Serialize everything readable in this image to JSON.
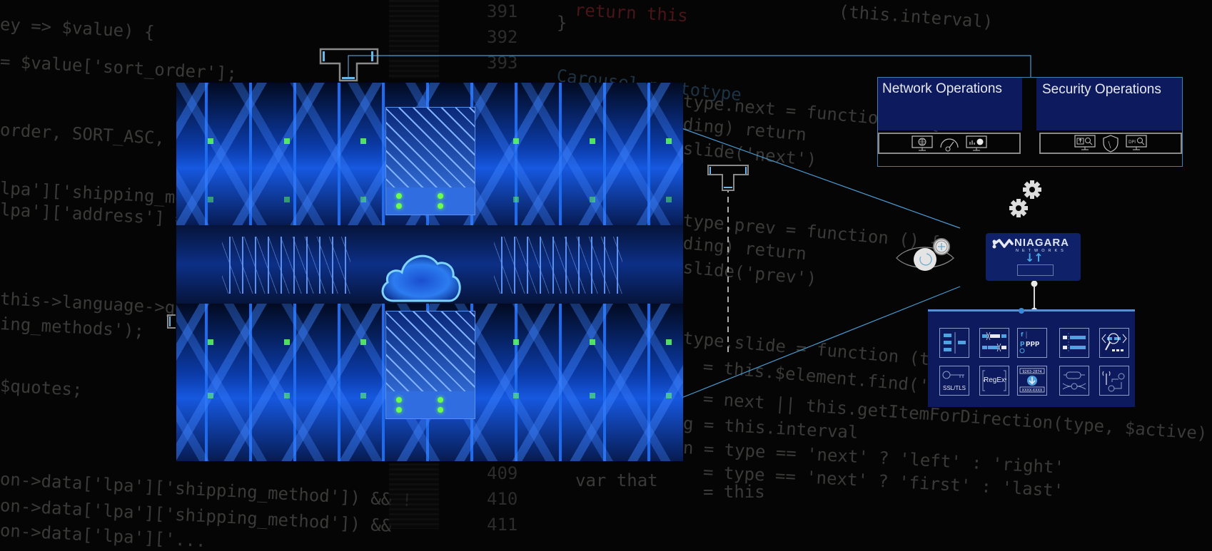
{
  "diagram": {
    "background_code": {
      "left_lines": [
        "ey => $value) {",
        "= $value['sort_order'];",
        "order, SORT_ASC, $qu",
        "lpa']['shipping_meth",
        "lpa']['address'] = $",
        "this->language->get(",
        "ing_methods');",
        "$quotes;",
        "on->data['lpa']['shipping_method']) && !",
        "on->data['lpa']['shipping_method']) &&",
        "on->data['lpa']['..."
      ],
      "line_numbers": [
        "391",
        "392",
        "393",
        "409",
        "410",
        "411"
      ],
      "top_center": [
        "return this",
        "}",
        "Carousel.prototype"
      ],
      "top_right": "(this.interval)",
      "right_lines": [
        "type.next = function () {",
        "ding) return",
        "slide('next')",
        "type.prev = function () {",
        "ding) return",
        "slide('prev')",
        "type.slide = function (type, next) {",
        "= this.$element.find('.item.active')",
        "= next || this.getItemForDirection(type, $active)",
        "g = this.interval",
        "n = type == 'next' ? 'left' : 'right'",
        "= type == 'next' ? 'first' : 'last'",
        "= this",
        "var that"
      ]
    },
    "hero_image": {
      "subject": "data-center-rack-with-cloud",
      "accent_color": "#1d6cf0"
    },
    "panels": {
      "network_operations": {
        "title": "Network Operations",
        "icons": [
          "globe-monitor-icon",
          "gauge-icon",
          "chart-monitor-icon"
        ]
      },
      "security_operations": {
        "title": "Security Operations",
        "icons": [
          "upload-search-monitor-icon",
          "shield-icon",
          "dpi-search-monitor-icon"
        ],
        "dpi_label": "DPI"
      }
    },
    "device": {
      "brand": "NIAGARA",
      "sub_brand": "NETWORKS",
      "arrows": "↓↑"
    },
    "toolbox": {
      "tiles": [
        {
          "name": "filter-tile",
          "label": ""
        },
        {
          "name": "packet-slicing-tile",
          "label": ""
        },
        {
          "name": "social-apps-tile",
          "label": ""
        },
        {
          "name": "header-stripping-tile",
          "label": ""
        },
        {
          "name": "code-inspection-tile",
          "label": ""
        },
        {
          "name": "ssl-tls-tile",
          "label": "SSL/TLS"
        },
        {
          "name": "regex-tile",
          "label": "RegEx"
        },
        {
          "name": "data-masking-tile",
          "label": "",
          "top_text": "9263-2874",
          "bottom_text": "XXXX-XXXX"
        },
        {
          "name": "tunnel-termination-tile",
          "label": ""
        },
        {
          "name": "wireless-network-tile",
          "label": ""
        }
      ]
    },
    "colors": {
      "background": "#050506",
      "panel_fill": "#0d1b5e",
      "connector_line": "#4a9ad0",
      "panel_border": "#3d82b5"
    }
  }
}
